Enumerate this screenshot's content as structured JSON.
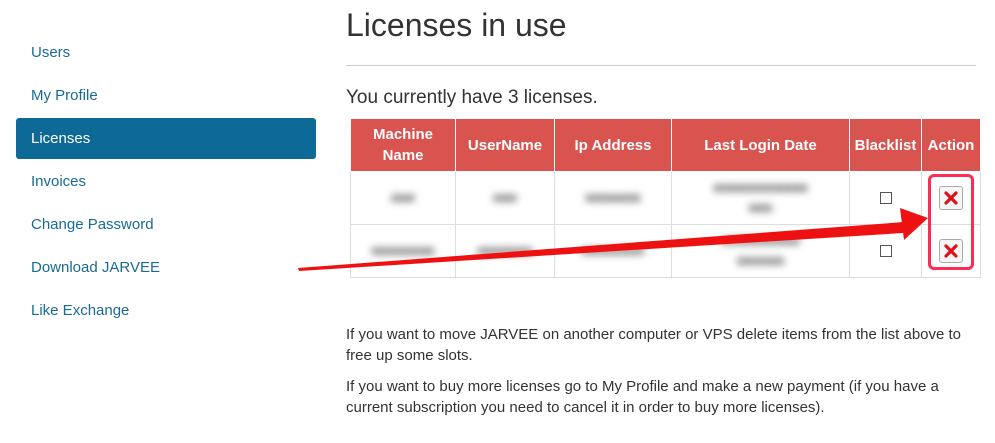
{
  "sidebar": {
    "items": [
      {
        "label": "Users"
      },
      {
        "label": "My Profile"
      },
      {
        "label": "Licenses",
        "active": true
      },
      {
        "label": "Invoices"
      },
      {
        "label": "Change Password"
      },
      {
        "label": "Download JARVEE"
      },
      {
        "label": "Like Exchange"
      }
    ]
  },
  "main": {
    "title": "Licenses in use",
    "count_text": "You currently have 3 licenses.",
    "table": {
      "headers": {
        "machine_line1": "Machine",
        "machine_line2": "Name",
        "username": "UserName",
        "ip": "Ip Address",
        "last_login": "Last Login Date",
        "blacklist": "Blacklist",
        "action": "Action"
      }
    },
    "info1": "If you want to move JARVEE on another computer or VPS delete items from the list above to free up some slots.",
    "info2": "If you want to buy more licenses go to My Profile and make a new payment (if you have a current subscription you need to cancel it in order to buy more licenses)."
  },
  "colors": {
    "header_bg": "#d9534f",
    "active_nav": "#0d6a97",
    "link": "#1a6a96",
    "annotation": "#ff2a55",
    "arrow": "#ee1111"
  },
  "icons": {
    "delete": "delete-x-icon",
    "checkbox": "blacklist-checkbox"
  }
}
